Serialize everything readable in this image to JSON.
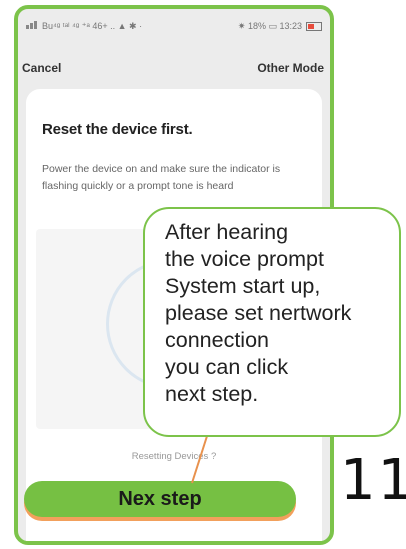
{
  "statusbar": {
    "left": "Bu⁴ᵍ ᵗᵃˡ ⁴ᵍ ⁺ᵃ 46+ .. ▲ ✱ ·",
    "right": "✷ 18% ▭ 13:23"
  },
  "topbar": {
    "cancel": "Cancel",
    "other_mode": "Other Mode"
  },
  "card": {
    "title": "Reset the device first.",
    "description": "Power the device on and make sure the indicator is flashing quickly or a prompt tone is heard"
  },
  "reset_link": "Resetting Devices ?",
  "next_button": "Nex step",
  "bubble": {
    "lines": [
      "After hearing",
      "the voice prompt",
      "System start up,",
      "please set nertwork",
      "connection",
      "you can click",
      "next step."
    ]
  },
  "page_number": "11",
  "colors": {
    "accent_green": "#7cc34a",
    "button_green": "#76c043",
    "button_shadow": "#f2a05c"
  }
}
